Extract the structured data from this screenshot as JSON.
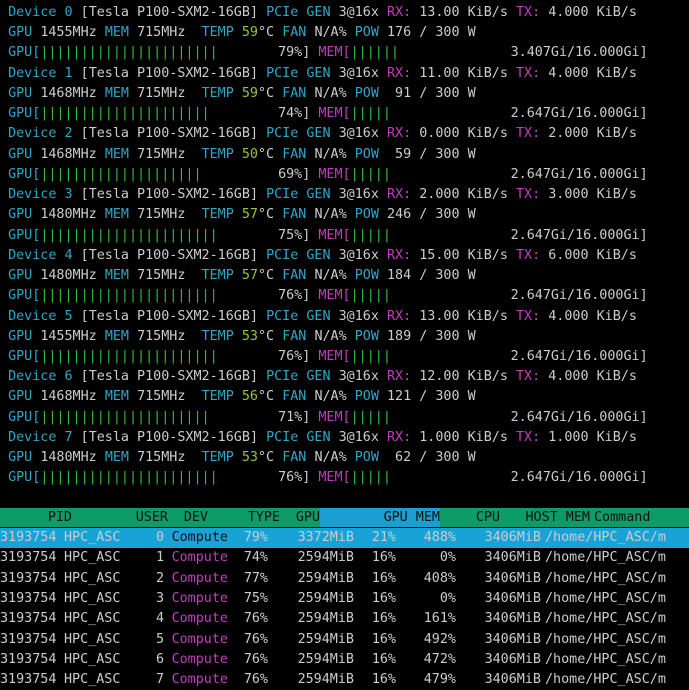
{
  "devices": [
    {
      "label": "Device 0",
      "model": "Tesla P100-SXM2-16GB",
      "pcie_label": "PCIe GEN",
      "pcie": "3@16x",
      "rx_label": "RX:",
      "rx": "13.00 KiB/s",
      "tx_label": "TX:",
      "tx": "4.000 KiB/s",
      "gpu_label": "GPU",
      "clock": "1455MHz",
      "mem_label": "MEM",
      "mem_clock": "715MHz",
      "temp_label": "TEMP",
      "temp": "59",
      "temp_unit": "°C",
      "fan_label": "FAN",
      "fan": "N/A%",
      "pow_label": "POW",
      "pow": "176 / 300 W",
      "util_bar": "GPU[",
      "util_ticks": "||||||||||||||||||||||",
      "util_pct": "79%]",
      "mem_bar": "MEM[",
      "mem_ticks": "||||||",
      "mem_usage": "3.407Gi/16.000Gi]"
    },
    {
      "label": "Device 1",
      "model": "Tesla P100-SXM2-16GB",
      "pcie_label": "PCIe GEN",
      "pcie": "3@16x",
      "rx_label": "RX:",
      "rx": "11.00 KiB/s",
      "tx_label": "TX:",
      "tx": "4.000 KiB/s",
      "gpu_label": "GPU",
      "clock": "1468MHz",
      "mem_label": "MEM",
      "mem_clock": "715MHz",
      "temp_label": "TEMP",
      "temp": "59",
      "temp_unit": "°C",
      "fan_label": "FAN",
      "fan": "N/A%",
      "pow_label": "POW",
      "pow": " 91 / 300 W",
      "util_bar": "GPU[",
      "util_ticks": "|||||||||||||||||||||",
      "util_pct": "74%]",
      "mem_bar": "MEM[",
      "mem_ticks": "|||||",
      "mem_usage": "2.647Gi/16.000Gi]"
    },
    {
      "label": "Device 2",
      "model": "Tesla P100-SXM2-16GB",
      "pcie_label": "PCIe GEN",
      "pcie": "3@16x",
      "rx_label": "RX:",
      "rx": "0.000 KiB/s",
      "tx_label": "TX:",
      "tx": "2.000 KiB/s",
      "gpu_label": "GPU",
      "clock": "1468MHz",
      "mem_label": "MEM",
      "mem_clock": "715MHz",
      "temp_label": "TEMP",
      "temp": "50",
      "temp_unit": "°C",
      "fan_label": "FAN",
      "fan": "N/A%",
      "pow_label": "POW",
      "pow": " 59 / 300 W",
      "util_bar": "GPU[",
      "util_ticks": "||||||||||||||||||||",
      "util_pct": "69%]",
      "mem_bar": "MEM[",
      "mem_ticks": "|||||",
      "mem_usage": "2.647Gi/16.000Gi]"
    },
    {
      "label": "Device 3",
      "model": "Tesla P100-SXM2-16GB",
      "pcie_label": "PCIe GEN",
      "pcie": "3@16x",
      "rx_label": "RX:",
      "rx": "2.000 KiB/s",
      "tx_label": "TX:",
      "tx": "3.000 KiB/s",
      "gpu_label": "GPU",
      "clock": "1480MHz",
      "mem_label": "MEM",
      "mem_clock": "715MHz",
      "temp_label": "TEMP",
      "temp": "57",
      "temp_unit": "°C",
      "fan_label": "FAN",
      "fan": "N/A%",
      "pow_label": "POW",
      "pow": "246 / 300 W",
      "util_bar": "GPU[",
      "util_ticks": "||||||||||||||||||||||",
      "util_pct": "75%]",
      "mem_bar": "MEM[",
      "mem_ticks": "|||||",
      "mem_usage": "2.647Gi/16.000Gi]"
    },
    {
      "label": "Device 4",
      "model": "Tesla P100-SXM2-16GB",
      "pcie_label": "PCIe GEN",
      "pcie": "3@16x",
      "rx_label": "RX:",
      "rx": "15.00 KiB/s",
      "tx_label": "TX:",
      "tx": "6.000 KiB/s",
      "gpu_label": "GPU",
      "clock": "1480MHz",
      "mem_label": "MEM",
      "mem_clock": "715MHz",
      "temp_label": "TEMP",
      "temp": "57",
      "temp_unit": "°C",
      "fan_label": "FAN",
      "fan": "N/A%",
      "pow_label": "POW",
      "pow": "184 / 300 W",
      "util_bar": "GPU[",
      "util_ticks": "||||||||||||||||||||||",
      "util_pct": "76%]",
      "mem_bar": "MEM[",
      "mem_ticks": "|||||",
      "mem_usage": "2.647Gi/16.000Gi]"
    },
    {
      "label": "Device 5",
      "model": "Tesla P100-SXM2-16GB",
      "pcie_label": "PCIe GEN",
      "pcie": "3@16x",
      "rx_label": "RX:",
      "rx": "13.00 KiB/s",
      "tx_label": "TX:",
      "tx": "4.000 KiB/s",
      "gpu_label": "GPU",
      "clock": "1455MHz",
      "mem_label": "MEM",
      "mem_clock": "715MHz",
      "temp_label": "TEMP",
      "temp": "53",
      "temp_unit": "°C",
      "fan_label": "FAN",
      "fan": "N/A%",
      "pow_label": "POW",
      "pow": "189 / 300 W",
      "util_bar": "GPU[",
      "util_ticks": "||||||||||||||||||||||",
      "util_pct": "76%]",
      "mem_bar": "MEM[",
      "mem_ticks": "|||||",
      "mem_usage": "2.647Gi/16.000Gi]"
    },
    {
      "label": "Device 6",
      "model": "Tesla P100-SXM2-16GB",
      "pcie_label": "PCIe GEN",
      "pcie": "3@16x",
      "rx_label": "RX:",
      "rx": "12.00 KiB/s",
      "tx_label": "TX:",
      "tx": "4.000 KiB/s",
      "gpu_label": "GPU",
      "clock": "1468MHz",
      "mem_label": "MEM",
      "mem_clock": "715MHz",
      "temp_label": "TEMP",
      "temp": "56",
      "temp_unit": "°C",
      "fan_label": "FAN",
      "fan": "N/A%",
      "pow_label": "POW",
      "pow": "121 / 300 W",
      "util_bar": "GPU[",
      "util_ticks": "|||||||||||||||||||||",
      "util_pct": "71%]",
      "mem_bar": "MEM[",
      "mem_ticks": "|||||",
      "mem_usage": "2.647Gi/16.000Gi]"
    },
    {
      "label": "Device 7",
      "model": "Tesla P100-SXM2-16GB",
      "pcie_label": "PCIe GEN",
      "pcie": "3@16x",
      "rx_label": "RX:",
      "rx": "1.000 KiB/s",
      "tx_label": "TX:",
      "tx": "1.000 KiB/s",
      "gpu_label": "GPU",
      "clock": "1480MHz",
      "mem_label": "MEM",
      "mem_clock": "715MHz",
      "temp_label": "TEMP",
      "temp": "53",
      "temp_unit": "°C",
      "fan_label": "FAN",
      "fan": "N/A%",
      "pow_label": "POW",
      "pow": " 62 / 300 W",
      "util_bar": "GPU[",
      "util_ticks": "||||||||||||||||||||||",
      "util_pct": "76%]",
      "mem_bar": "MEM[",
      "mem_ticks": "|||||",
      "mem_usage": "2.647Gi/16.000Gi]"
    }
  ],
  "process_header": {
    "pid": "PID",
    "user": "USER",
    "dev": "DEV",
    "type": "TYPE",
    "gpu": "GPU",
    "gpu_mem": "GPU MEM",
    "cpu": "CPU",
    "host_mem": "HOST MEM",
    "command": "Command"
  },
  "processes": [
    {
      "pid": "3193754",
      "user": "HPC_ASC",
      "dev": "0",
      "type": "Compute",
      "gpu": "79%",
      "gpu_mem": "3372MiB",
      "gpu_mem_pct": "21%",
      "cpu": "488%",
      "host_mem": "3406MiB",
      "command": "/home/HPC_ASC/m",
      "selected": true
    },
    {
      "pid": "3193754",
      "user": "HPC_ASC",
      "dev": "1",
      "type": "Compute",
      "gpu": "74%",
      "gpu_mem": "2594MiB",
      "gpu_mem_pct": "16%",
      "cpu": "0%",
      "host_mem": "3406MiB",
      "command": "/home/HPC_ASC/m"
    },
    {
      "pid": "3193754",
      "user": "HPC_ASC",
      "dev": "2",
      "type": "Compute",
      "gpu": "77%",
      "gpu_mem": "2594MiB",
      "gpu_mem_pct": "16%",
      "cpu": "408%",
      "host_mem": "3406MiB",
      "command": "/home/HPC_ASC/m"
    },
    {
      "pid": "3193754",
      "user": "HPC_ASC",
      "dev": "3",
      "type": "Compute",
      "gpu": "75%",
      "gpu_mem": "2594MiB",
      "gpu_mem_pct": "16%",
      "cpu": "0%",
      "host_mem": "3406MiB",
      "command": "/home/HPC_ASC/m"
    },
    {
      "pid": "3193754",
      "user": "HPC_ASC",
      "dev": "4",
      "type": "Compute",
      "gpu": "76%",
      "gpu_mem": "2594MiB",
      "gpu_mem_pct": "16%",
      "cpu": "161%",
      "host_mem": "3406MiB",
      "command": "/home/HPC_ASC/m"
    },
    {
      "pid": "3193754",
      "user": "HPC_ASC",
      "dev": "5",
      "type": "Compute",
      "gpu": "76%",
      "gpu_mem": "2594MiB",
      "gpu_mem_pct": "16%",
      "cpu": "492%",
      "host_mem": "3406MiB",
      "command": "/home/HPC_ASC/m"
    },
    {
      "pid": "3193754",
      "user": "HPC_ASC",
      "dev": "6",
      "type": "Compute",
      "gpu": "76%",
      "gpu_mem": "2594MiB",
      "gpu_mem_pct": "16%",
      "cpu": "472%",
      "host_mem": "3406MiB",
      "command": "/home/HPC_ASC/m"
    },
    {
      "pid": "3193754",
      "user": "HPC_ASC",
      "dev": "7",
      "type": "Compute",
      "gpu": "76%",
      "gpu_mem": "2594MiB",
      "gpu_mem_pct": "16%",
      "cpu": "479%",
      "host_mem": "3406MiB",
      "command": "/home/HPC_ASC/m"
    }
  ],
  "colors": {
    "background": "#000000",
    "cyan": "#2fa6c8",
    "magenta": "#c23dbd",
    "green": "#8fc73e",
    "bar": "#2fbf3a",
    "header_green": "#0d9b6a",
    "header_blue": "#1a9fd0",
    "selected_row": "#19a2d6",
    "text": "#cccccc"
  }
}
